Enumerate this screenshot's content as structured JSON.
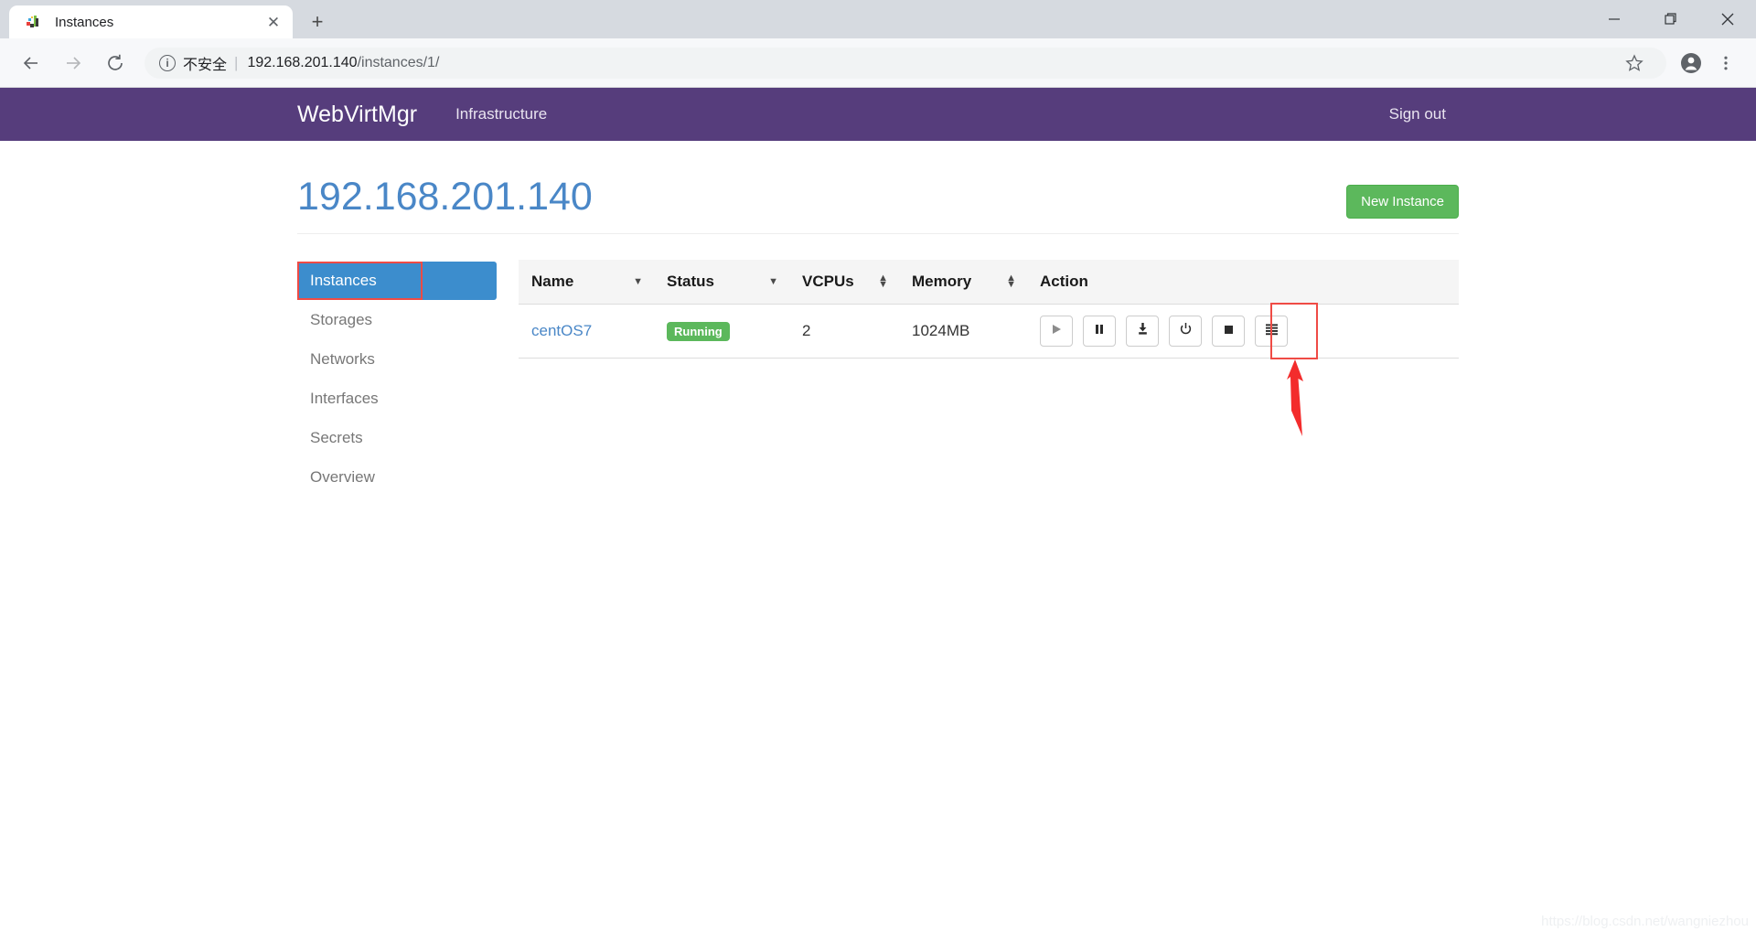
{
  "browser": {
    "tab": {
      "title": "Instances",
      "favicon_icon": "webvirtmgr-favicon",
      "close_icon": "close-icon"
    },
    "new_tab_label": "+",
    "window_controls": {
      "minimize": "—",
      "maximize": "□",
      "close": "✕"
    },
    "nav": {
      "back_icon": "back-arrow-icon",
      "forward_icon": "forward-arrow-icon",
      "reload_icon": "reload-icon"
    },
    "omnibox": {
      "info_icon": "info-circle-icon",
      "security_label": "不安全",
      "separator": "|",
      "url_host": "192.168.201.140",
      "url_path": "/instances/1/"
    },
    "toolbar_right": {
      "bookmark_icon": "star-icon",
      "profile_icon": "profile-avatar-icon",
      "menu_icon": "three-dot-menu-icon"
    }
  },
  "navbar": {
    "brand": "WebVirtMgr",
    "links": [
      {
        "label": "Infrastructure"
      }
    ],
    "signout_label": "Sign out",
    "background_color": "#563d7c"
  },
  "page": {
    "title": "192.168.201.140",
    "title_color": "#4a87c7",
    "new_instance_label": "New Instance",
    "new_instance_color": "#5cb85c"
  },
  "sidebar": {
    "items": [
      {
        "label": "Instances",
        "active": true
      },
      {
        "label": "Storages",
        "active": false
      },
      {
        "label": "Networks",
        "active": false
      },
      {
        "label": "Interfaces",
        "active": false
      },
      {
        "label": "Secrets",
        "active": false
      },
      {
        "label": "Overview",
        "active": false
      }
    ],
    "active_color": "#3c8dcd"
  },
  "table": {
    "columns": [
      {
        "label": "Name",
        "sort": "caret"
      },
      {
        "label": "Status",
        "sort": "caret"
      },
      {
        "label": "VCPUs",
        "sort": "both"
      },
      {
        "label": "Memory",
        "sort": "both"
      },
      {
        "label": "Action",
        "sort": "none"
      }
    ],
    "rows": [
      {
        "name": "centOS7",
        "status": "Running",
        "status_color": "#5cb85c",
        "vcpus": "2",
        "memory": "1024MB",
        "actions": [
          {
            "icon": "play-icon",
            "disabled": true
          },
          {
            "icon": "pause-icon",
            "disabled": false
          },
          {
            "icon": "snapshot-download-icon",
            "disabled": false
          },
          {
            "icon": "power-icon",
            "disabled": false
          },
          {
            "icon": "stop-icon",
            "disabled": false
          },
          {
            "icon": "console-hamburger-icon",
            "disabled": false
          }
        ]
      }
    ]
  },
  "annotations": {
    "highlight_color": "#ef4b45",
    "arrow_color": "#f32c2c",
    "sidebar_highlight": "instances-nav-item",
    "action_highlight": "console-hamburger-button"
  },
  "watermark": {
    "text": "https://blog.csdn.net/wangniezhou"
  }
}
